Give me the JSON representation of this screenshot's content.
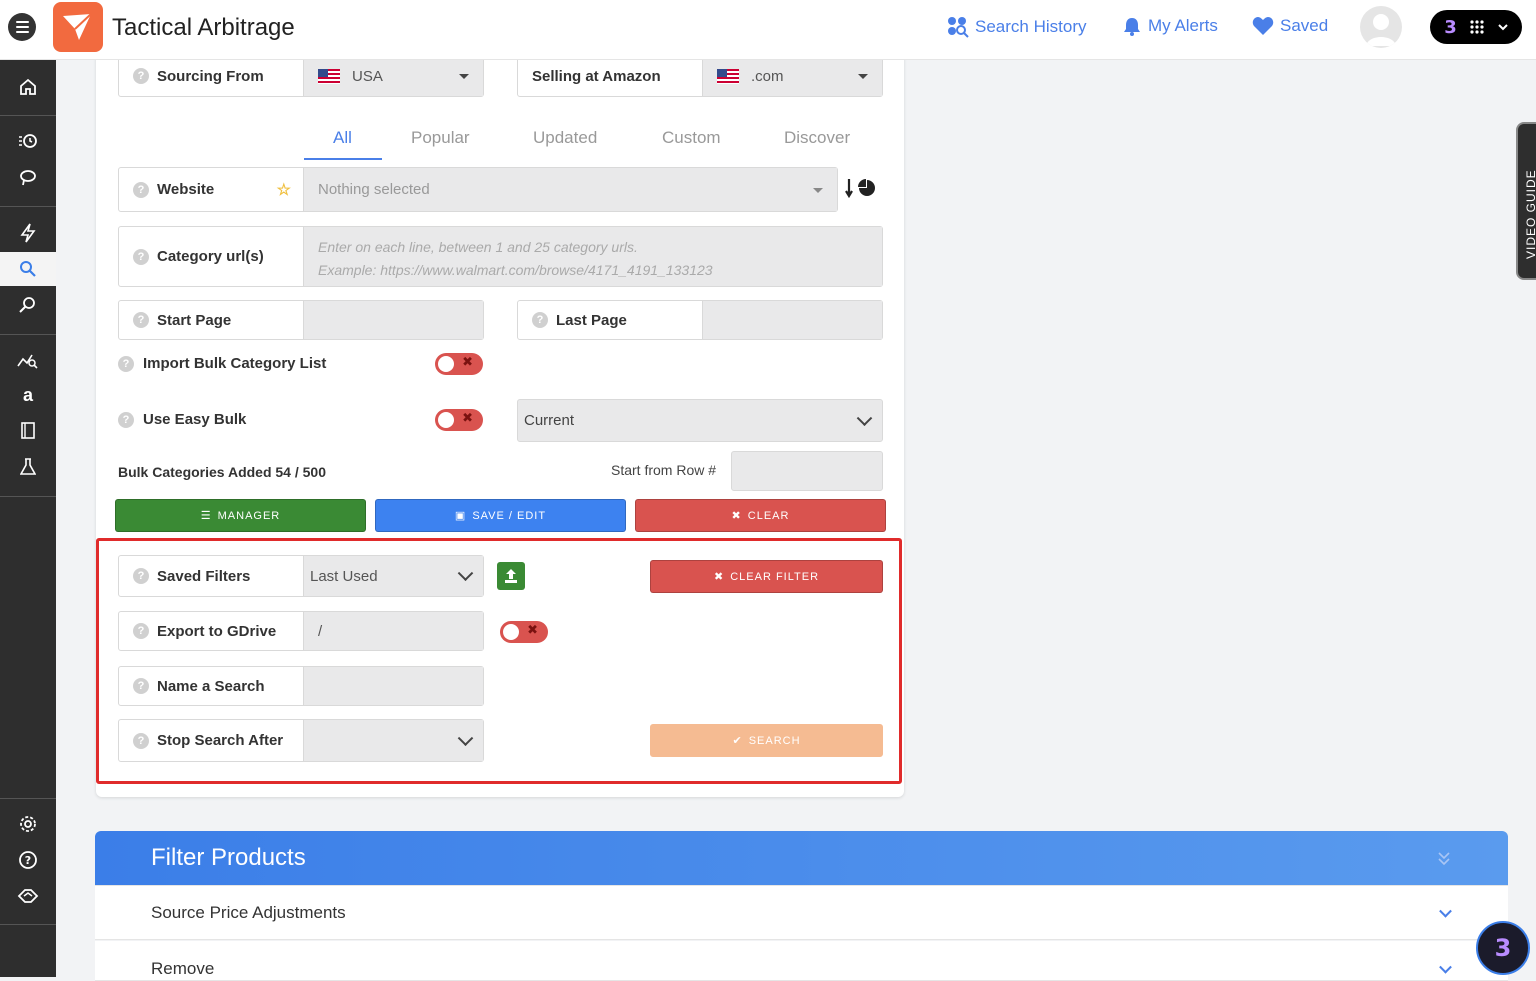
{
  "header": {
    "app_title": "Tactical Arbitrage",
    "nav": [
      {
        "label": "Search History",
        "icon": "search-history-icon"
      },
      {
        "label": "My Alerts",
        "icon": "bell-icon"
      },
      {
        "label": "Saved",
        "icon": "heart-icon"
      }
    ]
  },
  "colors": {
    "accent": "#4a7fe8",
    "brand": "#f26a3f",
    "danger": "#d9534f",
    "success": "#3a8a34",
    "primary_button": "#3d82f0"
  },
  "form": {
    "sourcing_from": {
      "label": "Sourcing From",
      "value": "USA"
    },
    "selling_at": {
      "label": "Selling at Amazon",
      "value": ".com"
    },
    "tabs": [
      "All",
      "Popular",
      "Updated",
      "Custom",
      "Discover"
    ],
    "active_tab": "All",
    "website": {
      "label": "Website",
      "placeholder": "Nothing selected"
    },
    "category_urls": {
      "label": "Category url(s)",
      "placeholder_line1": "Enter on each line, between 1 and 25 category urls.",
      "placeholder_line2": "Example: https://www.walmart.com/browse/4171_4191_133123"
    },
    "start_page": {
      "label": "Start Page"
    },
    "last_page": {
      "label": "Last Page"
    },
    "import_bulk": {
      "label": "Import Bulk Category List"
    },
    "easy_bulk": {
      "label": "Use Easy Bulk",
      "select_value": "Current"
    },
    "bulk_count": "Bulk Categories Added 54 / 500",
    "start_from_row": "Start from Row #",
    "buttons": {
      "manager": "MANAGER",
      "save_edit": "SAVE / EDIT",
      "clear": "CLEAR"
    }
  },
  "filters": {
    "saved_filters": {
      "label": "Saved Filters",
      "value": "Last Used"
    },
    "clear_filter": "CLEAR FILTER",
    "export_gdrive": {
      "label": "Export to GDrive",
      "value": "/"
    },
    "name_search": {
      "label": "Name a Search"
    },
    "stop_after": {
      "label": "Stop Search After"
    },
    "search": "SEARCH"
  },
  "panels": {
    "filter_products": "Filter Products",
    "source_price": "Source Price Adjustments",
    "remove": "Remove"
  },
  "video_guide": "VIDEO GUIDE"
}
